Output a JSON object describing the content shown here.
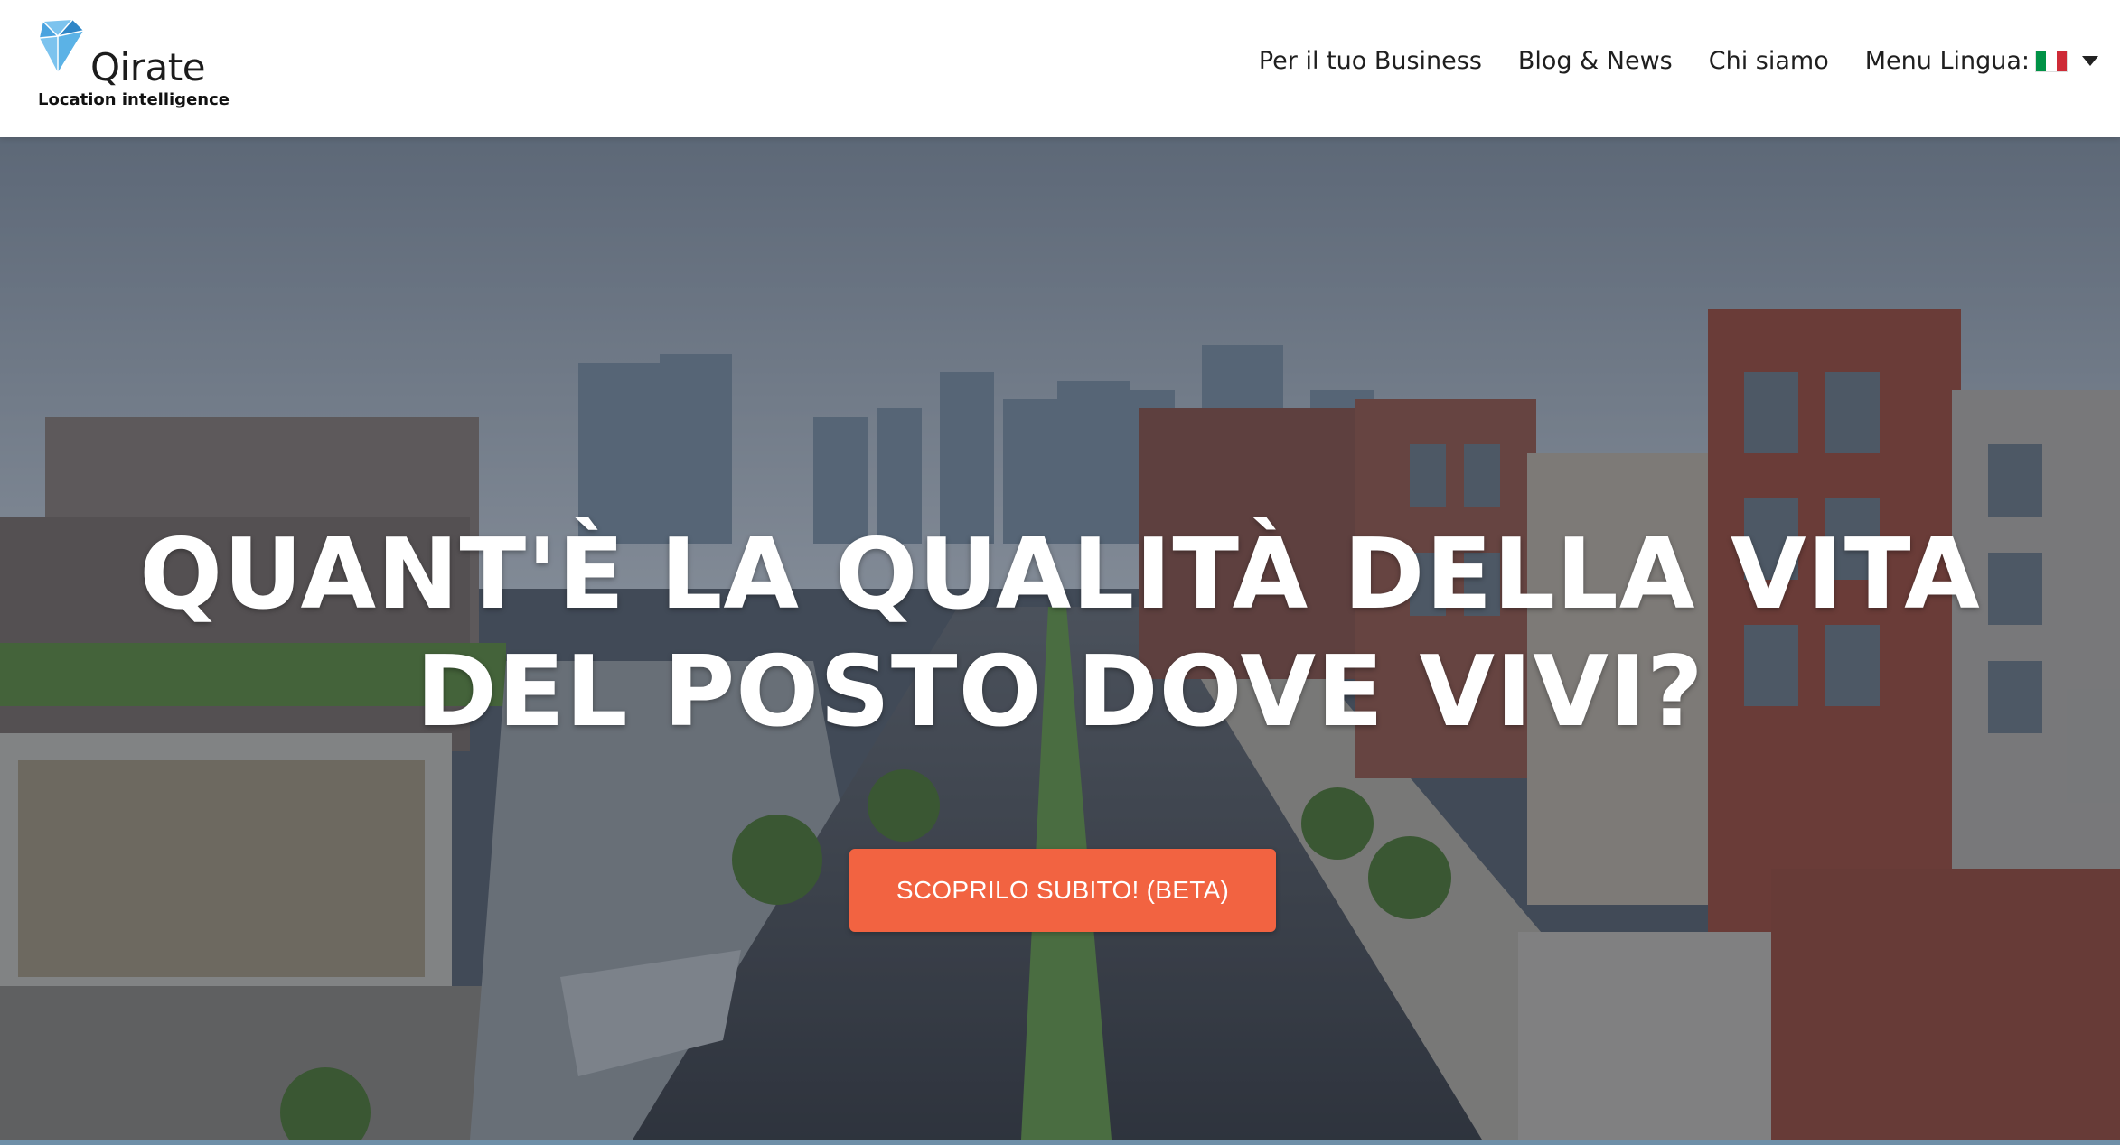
{
  "brand": {
    "name": "Qirate",
    "tagline": "Location intelligence",
    "logo_icon": "diamond-logo-icon",
    "logo_color": "#4aa3df"
  },
  "nav": {
    "items": [
      {
        "label": "Per il tuo Business"
      },
      {
        "label": "Blog & News"
      },
      {
        "label": "Chi siamo"
      }
    ],
    "language_menu": {
      "label": "Menu Lingua:",
      "flag_icon": "italy-flag-icon",
      "caret_icon": "caret-down-icon"
    }
  },
  "hero": {
    "title": "QUANT'È LA QUALITÀ DELLA VITA DEL POSTO DOVE VIVI?",
    "cta_label": "SCOPRILO SUBITO! (BETA)",
    "background": "city-street-illustration"
  },
  "colors": {
    "cta": "#f26341",
    "nav_text": "#1f1f1f",
    "hero_overlay": "rgba(30,38,52,0.42)"
  }
}
